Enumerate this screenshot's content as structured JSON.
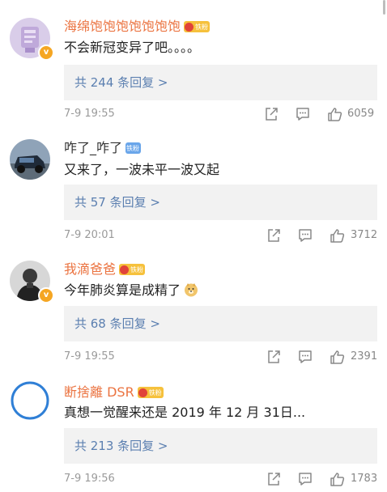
{
  "comments": [
    {
      "username": "海绵饱饱饱饱饱饱饱",
      "fan_badge": "铁粉",
      "text": "不会新冠变异了吧。。。。",
      "replies": "共 244 条回复 >",
      "time": "7-9 19:55",
      "likes": "6059"
    },
    {
      "username": "咋了_咋了",
      "fan_badge": "铁粉",
      "text": "又来了，一波未平一波又起",
      "replies": "共 57 条回复 >",
      "time": "7-9 20:01",
      "likes": "3712"
    },
    {
      "username": "我滴爸爸",
      "fan_badge": "铁粉",
      "text": "今年肺炎算是成精了",
      "replies": "共 68 条回复 >",
      "time": "7-9 19:55",
      "likes": "2391"
    },
    {
      "username": "断捨離 DSR",
      "fan_badge": "铁粉",
      "text": "真想一觉醒来还是 2019 年 12 月 31日...",
      "replies": "共 213 条回复 >",
      "time": "7-9 19:56",
      "likes": "1783"
    }
  ],
  "icons": {
    "share": "share-icon",
    "comment": "comment-icon",
    "like": "like-icon",
    "emoji": "doge-emoji-icon"
  },
  "colors": {
    "username_vip": "#eb7340",
    "reply_link": "#5b7fb0",
    "reply_bg": "#f2f2f2",
    "meta_grey": "#9a9a9a"
  }
}
